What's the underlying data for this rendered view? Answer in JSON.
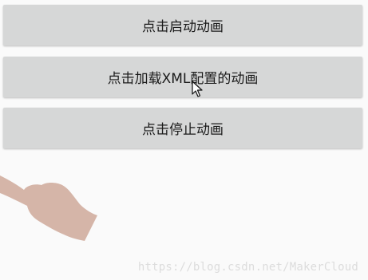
{
  "buttons": {
    "start_animation": "点击启动动画",
    "load_xml_animation": "点击加载XML配置的动画",
    "stop_animation": "点击停止动画"
  },
  "decorations": {
    "hand_icon": "hand-pointer-icon",
    "cursor_icon": "mouse-cursor-icon"
  },
  "watermark": "https://blog.csdn.net/MakerCloud",
  "colors": {
    "background": "#fafafa",
    "button": "#d6d7d7",
    "hand": "#d5b5a8",
    "watermark": "#dcdcdc"
  }
}
